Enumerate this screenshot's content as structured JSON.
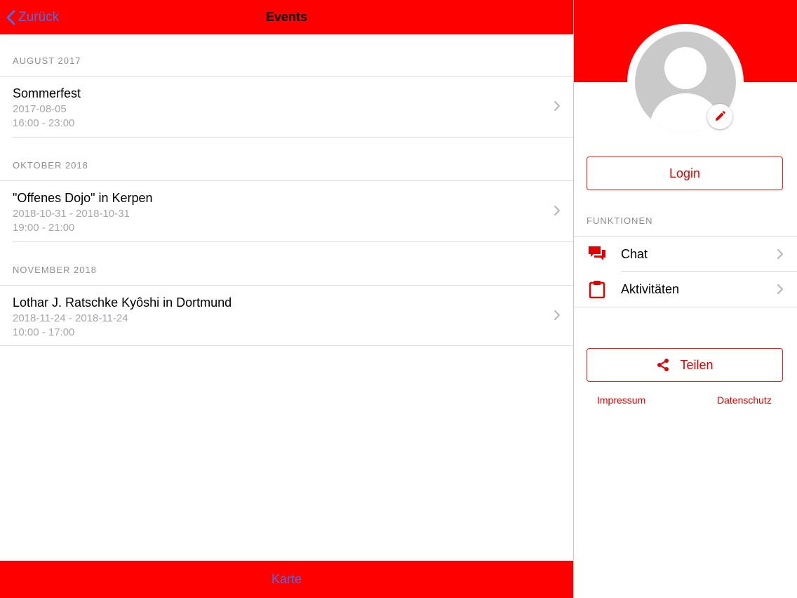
{
  "nav": {
    "back_label": "Zurück",
    "title": "Events"
  },
  "events": {
    "sections": [
      {
        "header": "AUGUST 2017",
        "item": {
          "title": "Sommerfest",
          "date": "2017-08-05",
          "time": "16:00 - 23:00"
        }
      },
      {
        "header": "OKTOBER 2018",
        "item": {
          "title": "\"Offenes Dojo\" in Kerpen",
          "date": "2018-10-31 - 2018-10-31",
          "time": "19:00 - 21:00"
        }
      },
      {
        "header": "NOVEMBER 2018",
        "item": {
          "title": "Lothar J. Ratschke Kyôshi in Dortmund",
          "date": "2018-11-24 - 2018-11-24",
          "time": "10:00 - 17:00"
        }
      }
    ]
  },
  "bottom": {
    "karte_label": "Karte"
  },
  "sidebar": {
    "login_label": "Login",
    "functions_header": "FUNKTIONEN",
    "functions": [
      {
        "label": "Chat",
        "icon": "chat-icon"
      },
      {
        "label": "Aktivitäten",
        "icon": "clipboard-icon"
      }
    ],
    "share_label": "Teilen",
    "share_icon": "share-icon",
    "impressum_label": "Impressum",
    "datenschutz_label": "Datenschutz"
  },
  "colors": {
    "brand": "#ff0000",
    "link_blue": "#4a6ee8",
    "secondary_text": "#a6a6ab"
  }
}
